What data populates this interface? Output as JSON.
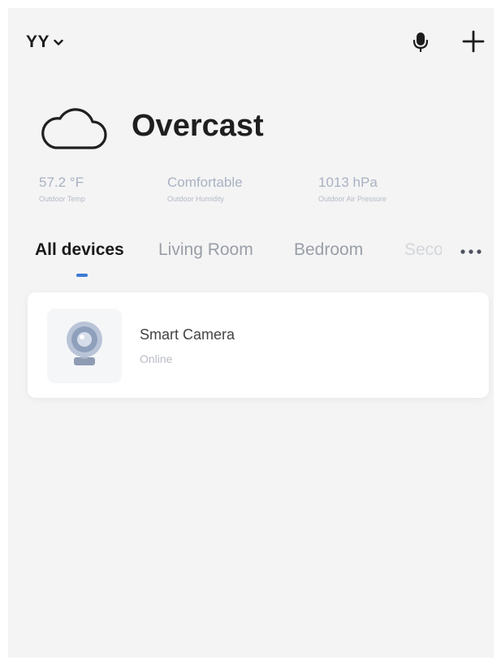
{
  "header": {
    "home_name": "YY",
    "chevron_icon": "chevron-down-icon",
    "mic_icon": "microphone-icon",
    "add_icon": "plus-icon"
  },
  "weather": {
    "icon": "cloud-icon",
    "condition": "Overcast",
    "stats": [
      {
        "value": "57.2 °F",
        "label": "Outdoor Temp"
      },
      {
        "value": "Comfortable",
        "label": "Outdoor Humidity"
      },
      {
        "value": "1013 hPa",
        "label": "Outdoor Air Pressure"
      }
    ]
  },
  "tabs": [
    {
      "label": "All devices",
      "active": true
    },
    {
      "label": "Living Room",
      "active": false
    },
    {
      "label": "Bedroom",
      "active": false
    },
    {
      "label": "Seco",
      "active": false
    }
  ],
  "more_icon": "more-horizontal-icon",
  "devices": [
    {
      "name": "Smart Camera",
      "status": "Online",
      "icon": "camera-icon"
    }
  ],
  "colors": {
    "background": "#f4f4f4",
    "card": "#ffffff",
    "accent": "#3a7bd5",
    "primary_text": "#1a1a1a",
    "muted_text": "#a9b1c3"
  }
}
